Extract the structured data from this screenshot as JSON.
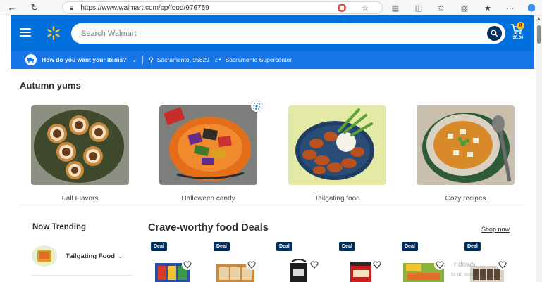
{
  "browser": {
    "url": "https://www.walmart.com/cp/food/976759",
    "icons": [
      "back-icon",
      "refresh-icon",
      "lock-icon",
      "extension-icon",
      "favorite-icon",
      "split-screen-icon",
      "favorites-bar-icon",
      "collections-icon",
      "browser-essentials-icon",
      "more-icon",
      "copilot-icon"
    ]
  },
  "header": {
    "search_placeholder": "Search Walmart",
    "cart_count": "0",
    "cart_total": "$0.00"
  },
  "subheader": {
    "question": "How do you want your items?",
    "location": "Sacramento, 95829",
    "store": "Sacramento Supercenter"
  },
  "autumn": {
    "title": "Autumn yums",
    "cards": [
      {
        "label": "Fall Flavors"
      },
      {
        "label": "Halloween candy"
      },
      {
        "label": "Tailgating food"
      },
      {
        "label": "Cozy recipes"
      }
    ]
  },
  "trending": {
    "title": "Now Trending",
    "item": "Tailgating Food"
  },
  "deals": {
    "title": "Crave-worthy food Deals",
    "shop_now": "Shop now",
    "badges": [
      "Deal",
      "Deal",
      "Deal",
      "Deal",
      "Deal",
      "Deal"
    ]
  },
  "watermark": {
    "line1": "ndows",
    "line2": "to ac     ows."
  },
  "colors": {
    "brand_blue": "#0071dc",
    "subheader_blue": "#1877e8",
    "spark_yellow": "#ffc220",
    "deal_navy": "#002d58"
  }
}
